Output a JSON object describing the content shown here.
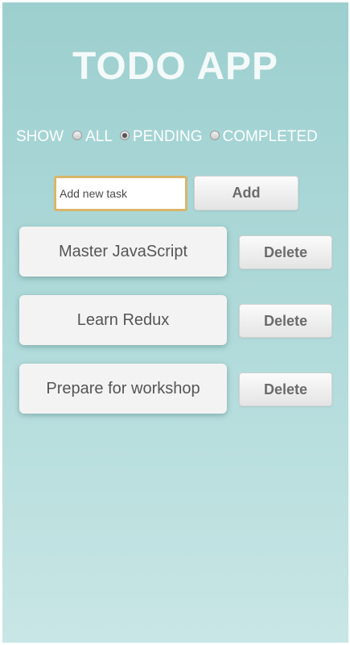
{
  "app": {
    "title": "TODO APP"
  },
  "filters": {
    "show_label": "SHOW",
    "options": [
      {
        "label": "ALL",
        "checked": false
      },
      {
        "label": "PENDING",
        "checked": true
      },
      {
        "label": "COMPLETED",
        "checked": false
      }
    ]
  },
  "new_task": {
    "value": "",
    "placeholder": "Add new task",
    "add_label": "Add"
  },
  "tasks": [
    {
      "text": "Master JavaScript",
      "delete_label": "Delete"
    },
    {
      "text": "Learn Redux",
      "delete_label": "Delete"
    },
    {
      "text": "Prepare for workshop",
      "delete_label": "Delete"
    }
  ],
  "colors": {
    "background_top": "#9dcfcf",
    "background_bottom": "#c8e6e5",
    "input_border": "#d9b56b",
    "button_text": "#6b6b6b",
    "task_text": "#555555"
  }
}
